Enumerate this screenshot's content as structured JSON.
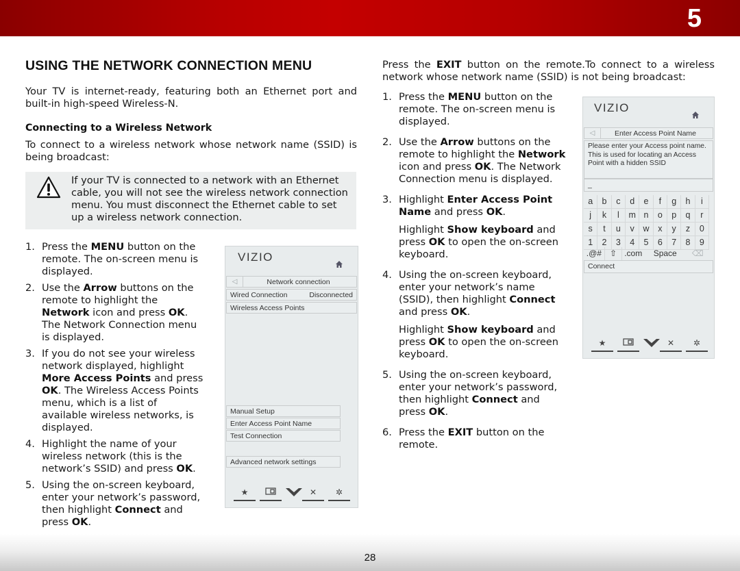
{
  "header": {
    "chapter": "5",
    "accent": "#c40000"
  },
  "footer": {
    "page_number": "28"
  },
  "left": {
    "title": "USING THE NETWORK CONNECTION MENU",
    "intro": "Your TV is internet-ready, featuring both an Ethernet port and built-in high-speed Wireless-N.",
    "subheading": "Connecting to a Wireless Network",
    "subintro": "To connect to a wireless network whose network name (SSID) is being broadcast:",
    "note": "If your TV is connected to a network with an Ethernet cable, you will not see the wireless network connection menu. You must disconnect the Ethernet cable to set up a wireless network connection.",
    "steps": [
      {
        "num": "1.",
        "parts": [
          "Press the ",
          "MENU",
          " button on the remote. The on-screen menu is displayed."
        ]
      },
      {
        "num": "2.",
        "parts": [
          "Use the ",
          "Arrow",
          " buttons on the remote to highlight the ",
          "Network",
          " icon and press ",
          "OK",
          ". The Network Connection menu is displayed."
        ]
      },
      {
        "num": "3.",
        "parts": [
          "If you do not see your wireless network displayed, highlight ",
          "More Access Points",
          " and press ",
          "OK",
          ". The Wireless Access Points menu, which is a list of available wireless networks, is displayed."
        ]
      },
      {
        "num": "4.",
        "parts": [
          "Highlight the name of your wireless network (this is the network’s SSID) and press ",
          "OK",
          "."
        ]
      },
      {
        "num": "5.",
        "parts": [
          "Using the on-screen keyboard, enter your network’s password, then highlight ",
          "Connect",
          " and press ",
          "OK",
          "."
        ]
      }
    ]
  },
  "right": {
    "intro": "Press the EXIT button on the remote. To connect to a wireless network whose network name (SSID) is not being broadcast:",
    "intro_parts": [
      "Press the ",
      "EXIT",
      " button on the remote.To connect to a wireless network whose network name (SSID) is not being broadcast:"
    ],
    "steps": [
      {
        "num": "1.",
        "parts": [
          "Press the ",
          "MENU",
          " button on the remote. The on-screen menu is displayed."
        ]
      },
      {
        "num": "2.",
        "parts": [
          "Use the ",
          "Arrow",
          " buttons on the remote to highlight the ",
          "Network",
          " icon and press ",
          "OK",
          ". The Network Connection menu is displayed."
        ]
      },
      {
        "num": "3.",
        "parts": [
          "Highlight ",
          "Enter Access Point Name",
          " and press ",
          "OK",
          "."
        ],
        "extra": [
          "Highlight ",
          "Show keyboard",
          " and press ",
          "OK",
          " to open the on-screen keyboard."
        ]
      },
      {
        "num": "4.",
        "parts": [
          "Using the on-screen keyboard, enter your network’s name (SSID), then highlight ",
          "Connect",
          " and press ",
          "OK",
          "."
        ],
        "extra": [
          "Highlight ",
          "Show keyboard",
          " and press ",
          "OK",
          " to open the on-screen keyboard."
        ]
      },
      {
        "num": "5.",
        "parts": [
          "Using the on-screen keyboard, enter your network’s password, then highlight ",
          "Connect",
          " and press ",
          "OK",
          "."
        ]
      },
      {
        "num": "6.",
        "parts": [
          "Press the ",
          "EXIT",
          " button on the remote."
        ]
      }
    ]
  },
  "tv_menu_1": {
    "logo": "VIZIO",
    "header": "Network connection",
    "wired_label": "Wired Connection",
    "wired_status": "Disconnected",
    "wireless": "Wireless Access Points",
    "items": [
      "Manual Setup",
      "Enter Access Point Name",
      "Test Connection"
    ],
    "advanced": "Advanced network settings",
    "toolbar": [
      "star-icon",
      "pip-icon",
      "vizio-v-icon",
      "close-icon",
      "gear-icon"
    ]
  },
  "tv_menu_2": {
    "logo": "VIZIO",
    "header": "Enter Access Point Name",
    "description": "Please enter your Access point name. This is used for locating an Access Point with a hidden SSID",
    "input_value": "_",
    "keyboard_rows": [
      [
        "a",
        "b",
        "c",
        "d",
        "e",
        "f",
        "g",
        "h",
        "i"
      ],
      [
        "j",
        "k",
        "l",
        "m",
        "n",
        "o",
        "p",
        "q",
        "r"
      ],
      [
        "s",
        "t",
        "u",
        "v",
        "w",
        "x",
        "y",
        "z",
        "0"
      ],
      [
        "1",
        "2",
        "3",
        "4",
        "5",
        "6",
        "7",
        "8",
        "9"
      ]
    ],
    "special_keys": {
      "symbols": ".@#",
      "shift": "⇧",
      "dotcom": ".com",
      "space": "Space",
      "backspace": "⌫"
    },
    "connect": "Connect",
    "toolbar": [
      "star-icon",
      "pip-icon",
      "vizio-v-icon",
      "close-icon",
      "gear-icon"
    ]
  }
}
